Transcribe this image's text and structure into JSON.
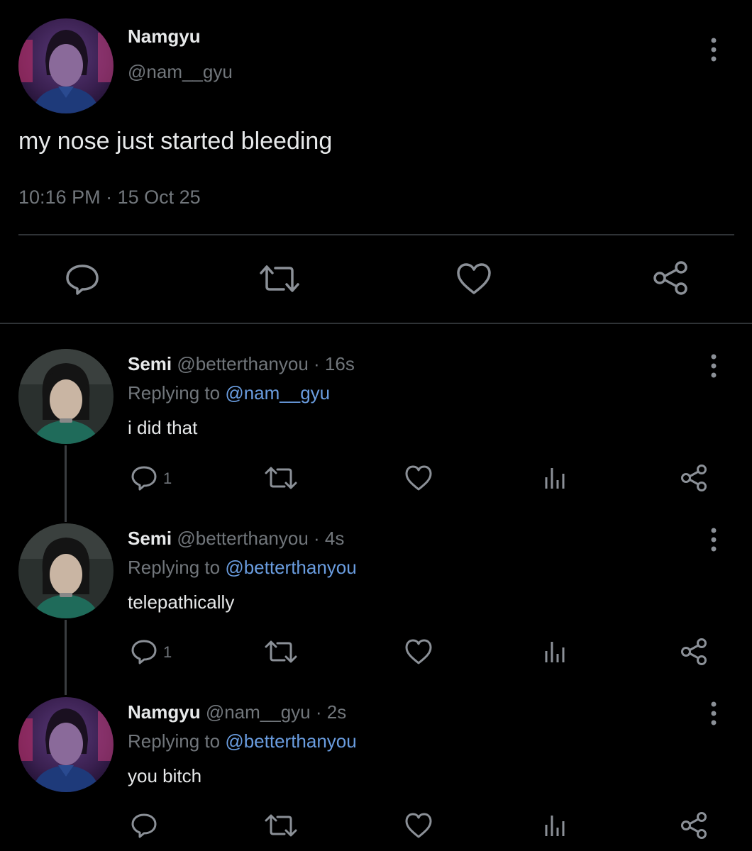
{
  "main_tweet": {
    "display_name": "Namgyu",
    "handle": "@nam__gyu",
    "text": "my nose just started bleeding",
    "time": "10:16 PM",
    "separator": "·",
    "date": "15 Oct 25",
    "icons": [
      "reply-icon",
      "retweet-icon",
      "like-icon",
      "share-icon"
    ]
  },
  "replies": [
    {
      "display_name": "Semi",
      "handle": "@betterthanyou",
      "time_ago": "· 16s",
      "replying_prefix": "Replying to",
      "replying_handle": "@nam__gyu",
      "text": "i did that",
      "reply_count": "1"
    },
    {
      "display_name": "Semi",
      "handle": "@betterthanyou",
      "time_ago": "· 4s",
      "replying_prefix": "Replying to",
      "replying_handle": "@betterthanyou",
      "text": "telepathically",
      "reply_count": "1"
    },
    {
      "display_name": "Namgyu",
      "handle": "@nam__gyu",
      "time_ago": "· 2s",
      "replying_prefix": "Replying to",
      "replying_handle": "@betterthanyou",
      "text": "you bitch",
      "reply_count": ""
    }
  ],
  "colors": {
    "background": "#000000",
    "text": "#e7e9ea",
    "muted": "#71767b",
    "link": "#6a9de0",
    "divider": "#2f3336"
  }
}
